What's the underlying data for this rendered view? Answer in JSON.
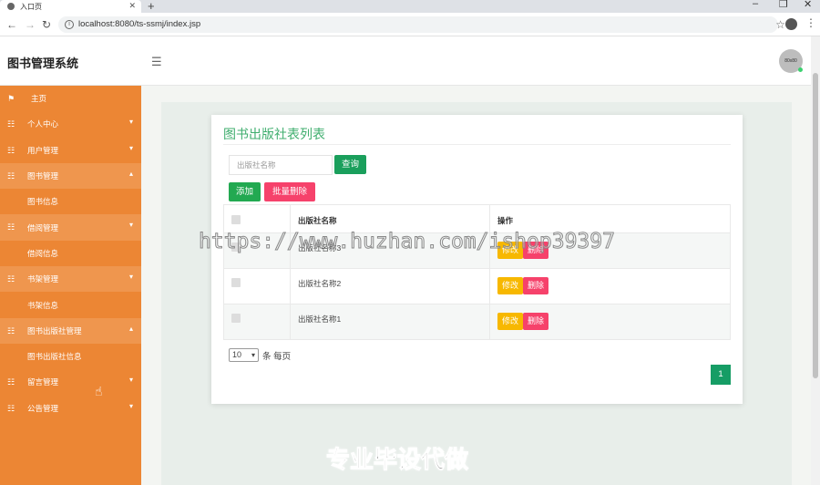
{
  "browser": {
    "tab_title": "入口页",
    "url": "localhost:8080/ts-ssmj/index.jsp"
  },
  "app": {
    "brand": "图书管理系统",
    "avatar_text": "80x80"
  },
  "sidebar": {
    "items": [
      {
        "label": "主页",
        "icon": "flag-icon",
        "has_chevron": false
      },
      {
        "label": "个人中心",
        "icon": "grid-icon",
        "chevron": "▾"
      },
      {
        "label": "用户管理",
        "icon": "grid-icon",
        "chevron": "▾"
      },
      {
        "label": "图书管理",
        "icon": "grid-icon",
        "chevron": "▴",
        "sub": "图书信息"
      },
      {
        "label": "借阅管理",
        "icon": "grid-icon",
        "chevron": "▾",
        "sub": "借阅信息"
      },
      {
        "label": "书架管理",
        "icon": "grid-icon",
        "chevron": "▾",
        "sub": "书架信息"
      },
      {
        "label": "图书出版社管理",
        "icon": "grid-icon",
        "chevron": "▴",
        "sub": "图书出版社信息"
      },
      {
        "label": "留言管理",
        "icon": "grid-icon",
        "chevron": "▾"
      },
      {
        "label": "公告管理",
        "icon": "grid-icon",
        "chevron": "▾"
      }
    ]
  },
  "card": {
    "title": "图书出版社表列表",
    "search_placeholder": "出版社名称",
    "search_button": "查询",
    "add_button": "添加",
    "bulk_delete_button": "批量删除"
  },
  "table": {
    "headers": [
      "",
      "出版社名称",
      "操作"
    ],
    "rows": [
      {
        "name": "出版社名称3"
      },
      {
        "name": "出版社名称2"
      },
      {
        "name": "出版社名称1"
      }
    ],
    "edit_label": "修改",
    "delete_label": "删除"
  },
  "pagination": {
    "page_size": "10",
    "page_size_suffix": "条 每页",
    "current_page": "1"
  },
  "overlay": {
    "watermark": "https://www.huzhan.com/ishop39397",
    "banner": "专业毕设代做"
  },
  "colors": {
    "sidebar_bg": "#ec8634",
    "accent_green": "#1a9f5c",
    "danger": "#f6426b",
    "warning": "#f7b800"
  }
}
